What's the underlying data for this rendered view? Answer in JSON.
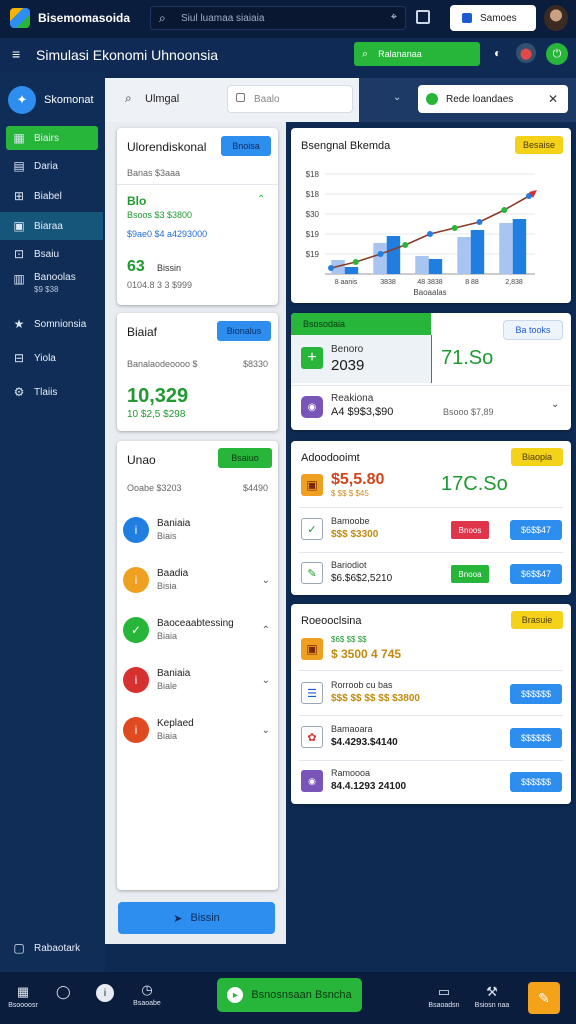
{
  "topbar": {
    "brand": "Bisemomasoida",
    "search_placeholder": "Siul luamaa siaiaia",
    "account_label": "Samoes"
  },
  "appbar": {
    "title": "Simulasi Ekonomi Uhnoonsia",
    "action_label": "Ralananaa"
  },
  "sidebar": {
    "header": "Skomonat",
    "items": [
      {
        "label": "Biairs",
        "icon": "grid-icon"
      },
      {
        "label": "Daria",
        "icon": "chart-icon"
      },
      {
        "label": "Biabel",
        "icon": "cart-icon"
      },
      {
        "label": "Biaraa",
        "icon": "box-icon"
      },
      {
        "label": "Bsaiu",
        "icon": "cart-icon"
      },
      {
        "label": "Banoolas",
        "sub": "$9 $38",
        "icon": "building-icon"
      },
      {
        "label": "Somnionsia",
        "icon": "star-icon"
      },
      {
        "label": "Yiola",
        "icon": "screen-icon"
      },
      {
        "label": "Tlaiis",
        "icon": "settings-icon"
      }
    ],
    "footer": "Rabaotark"
  },
  "filters": {
    "search_value": "Ulmgal",
    "select_placeholder": "Baalo",
    "tag_label": "Rede loandaes"
  },
  "left_panel": {
    "card1": {
      "title": "Ulorendiskonal",
      "button": "Bnoisa",
      "sub": "Banas $3aaa",
      "g1_title": "Blo",
      "g1_line1": "Bsoos $3 $3800",
      "g1_line2": "$9ae0 $4 a4293000",
      "g2_value": "63",
      "g2_label": "Bissin",
      "g2_line": "0104.8 3 3 $999"
    },
    "card2": {
      "title": "Biaiaf",
      "button": "Bionalus",
      "sub": "Banalaodeoooo $",
      "sub_value": "$8330",
      "value": "10,329",
      "value2": "10 $2,5 $298"
    },
    "card3": {
      "title": "Unao",
      "button": "Bsaiuo",
      "sub": "Ooabe $3203",
      "sub_value": "$4490",
      "rows": [
        {
          "label": "Baniaia",
          "sub": "Biais",
          "color": "#1f7ee0",
          "icon": "info-icon"
        },
        {
          "label": "Baadia",
          "sub": "Bisia",
          "color": "#f0a020",
          "icon": "info-icon"
        },
        {
          "label": "Baoceaabtessing",
          "sub": "Biaia",
          "color": "#27b53a",
          "icon": "check-icon"
        },
        {
          "label": "Baniaia",
          "sub": "Biale",
          "color": "#d63030",
          "icon": "info-icon"
        },
        {
          "label": "Keplaed",
          "sub": "Biaia",
          "color": "#e04a20",
          "icon": "info-icon"
        }
      ]
    },
    "primary_button": "Bissin"
  },
  "chart_card": {
    "title": "Bsengnal Bkemda",
    "button": "Besaise",
    "chart_data": {
      "type": "bar",
      "categories": [
        "8 aanis",
        "3838",
        "48 3838",
        "8 88",
        "2,838"
      ],
      "x_title": "Baoaalas",
      "y_ticks": [
        "$19",
        "$19",
        "$30",
        "$18",
        "$18"
      ],
      "series": [
        {
          "values": [
            14,
            31,
            18,
            37,
            51
          ],
          "color": "#a8c4f0"
        },
        {
          "values": [
            7,
            38,
            15,
            44,
            55
          ],
          "color": "#1f7ee0"
        }
      ],
      "trend": [
        6,
        12,
        20,
        29,
        40,
        46,
        52,
        64,
        78
      ],
      "trend_color": "#8b3a2a",
      "ylim": [
        0,
        100
      ]
    }
  },
  "stats_card": {
    "tab_label": "Bsosodaia",
    "button": "Ba tooks",
    "stat_label": "Benoro",
    "stat_value": "2039",
    "big_value": "71.So",
    "row_label": "Reakiona",
    "row_value": "A4 $9$3,$90",
    "row_right": "Bsooo $7,89"
  },
  "list_card1": {
    "title": "Adoodooimt",
    "button": "Biaopia",
    "hero_value": "$5,5.80",
    "hero_sub": "$ $$ $ $45",
    "hero_right": "17C.So",
    "rows": [
      {
        "label": "Bamoobe",
        "value": "$$$ $3300",
        "action": "Bnoos",
        "action_color": "#e0344a",
        "button": "$6$$47"
      },
      {
        "label": "Bariodiot",
        "value": "$6.$6$2,5210",
        "action": "Bnooa",
        "action_color": "#27b53a",
        "button": "$6$$47"
      }
    ]
  },
  "list_card2": {
    "title": "Roeooclsina",
    "button": "Brasuie",
    "hero_value": "$ 3500 4 745",
    "hero_sub": "$6$ $$ $$",
    "rows": [
      {
        "label": "Rorroob cu bas",
        "value": "$$$ $$ $$ $$ $3800",
        "button": "$$$$$$"
      },
      {
        "label": "Bamaoara",
        "value": "$4.4293.$4140",
        "button": "$$$$$$"
      },
      {
        "label": "Ramoooa",
        "value": "84.4.1293 24100",
        "button": "$$$$$$"
      }
    ]
  },
  "bottombar": {
    "items": [
      "Bsoooosr",
      "",
      "",
      "Bsaoabe"
    ],
    "primary": "Bsnosnsaan Bsncha",
    "right_items": [
      "Bsaoadsn",
      "Bsiosn naa"
    ]
  },
  "colors": {
    "accent_green": "#27b53a",
    "accent_blue": "#2d8ef0",
    "accent_yellow": "#f4d21a",
    "navy": "#0f2a55"
  }
}
